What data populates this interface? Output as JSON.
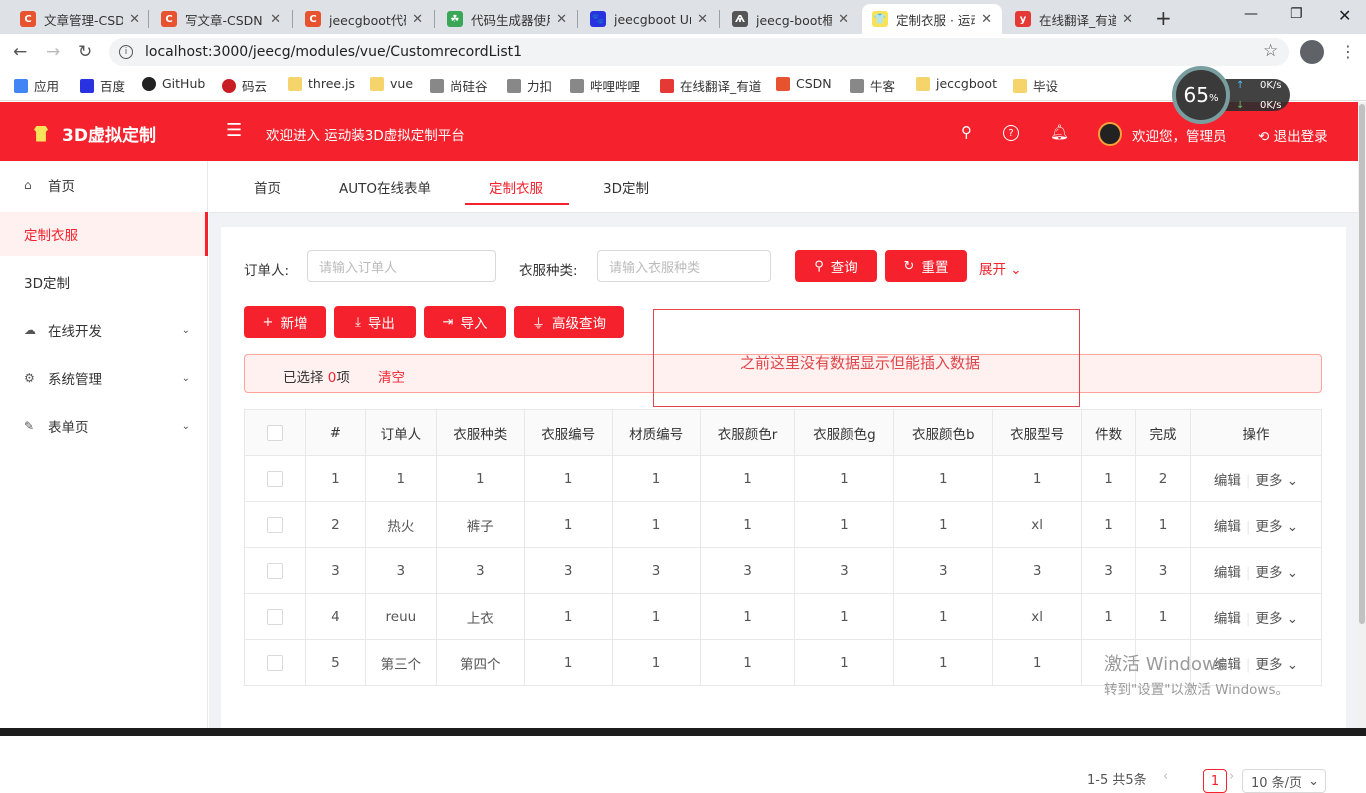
{
  "browser": {
    "tabs": [
      {
        "title": "文章管理-CSDN",
        "icon": "csdn-icon",
        "color": "#e8532f",
        "glyph": "C"
      },
      {
        "title": "写文章-CSDN",
        "icon": "csdn-icon",
        "color": "#e8532f",
        "glyph": "C"
      },
      {
        "title": "jeecgboot代码",
        "icon": "csdn-icon",
        "color": "#e8532f",
        "glyph": "C"
      },
      {
        "title": "代码生成器使用",
        "icon": "leaf-icon",
        "color": "#3aa757",
        "glyph": "☘"
      },
      {
        "title": "jeecgboot Un",
        "icon": "baidu-icon",
        "color": "#2932e1",
        "glyph": "🐾"
      },
      {
        "title": "jeecg-boot框",
        "icon": "jeecg-icon",
        "color": "#555555",
        "glyph": "Ѧ"
      },
      {
        "title": "定制衣服 · 运动",
        "icon": "shirt-icon",
        "color": "#f7e35a",
        "glyph": "👕"
      },
      {
        "title": "在线翻译_有道",
        "icon": "youdao-icon",
        "color": "#e53935",
        "glyph": "y"
      }
    ],
    "url": "localhost:3000/jeecg/modules/vue/CustomrecordList1",
    "bookmarks": [
      {
        "label": "应用",
        "type": "apps"
      },
      {
        "label": "百度",
        "type": "baidu"
      },
      {
        "label": "GitHub",
        "type": "github"
      },
      {
        "label": "码云",
        "type": "gitee"
      },
      {
        "label": "three.js",
        "type": "folder"
      },
      {
        "label": "vue",
        "type": "folder"
      },
      {
        "label": "尚硅谷",
        "type": "site"
      },
      {
        "label": "力扣",
        "type": "site"
      },
      {
        "label": "哔哩哔哩",
        "type": "site"
      },
      {
        "label": "在线翻译_有道",
        "type": "youdao"
      },
      {
        "label": "CSDN",
        "type": "csdn"
      },
      {
        "label": "牛客",
        "type": "site"
      },
      {
        "label": "jeccgboot",
        "type": "folder"
      },
      {
        "label": "毕设",
        "type": "folder"
      }
    ]
  },
  "header": {
    "app_title": "3D虚拟定制",
    "welcome": "欢迎进入 运动装3D虚拟定制平台",
    "user": "欢迎您，管理员",
    "logout": "退出登录"
  },
  "sidebar": {
    "items": [
      {
        "label": "首页",
        "icon": "home-icon"
      },
      {
        "label": "定制衣服",
        "active": true
      },
      {
        "label": "3D定制"
      },
      {
        "label": "在线开发",
        "icon": "cloud-icon",
        "expandable": true
      },
      {
        "label": "系统管理",
        "icon": "gear-icon",
        "expandable": true
      },
      {
        "label": "表单页",
        "icon": "form-icon",
        "expandable": true
      }
    ]
  },
  "page_tabs": [
    "首页",
    "AUTO在线表单",
    "定制衣服",
    "3D定制"
  ],
  "search": {
    "orderer_label": "订单人:",
    "orderer_placeholder": "请输入订单人",
    "type_label": "衣服种类:",
    "type_placeholder": "请输入衣服种类",
    "query": "查询",
    "reset": "重置",
    "expand": "展开"
  },
  "toolbar": {
    "add": "新增",
    "export": "导出",
    "import": "导入",
    "advanced": "高级查询"
  },
  "selection": {
    "prefix": "已选择",
    "count": "0",
    "suffix": "项",
    "clear": "清空"
  },
  "annotation": "之前这里没有数据显示但能插入数据",
  "table": {
    "columns": [
      "#",
      "订单人",
      "衣服种类",
      "衣服编号",
      "材质编号",
      "衣服颜色r",
      "衣服颜色g",
      "衣服颜色b",
      "衣服型号",
      "件数",
      "完成",
      "操作"
    ],
    "rows": [
      [
        "1",
        "1",
        "1",
        "1",
        "1",
        "1",
        "1",
        "1",
        "1",
        "1",
        "2"
      ],
      [
        "2",
        "热火",
        "裤子",
        "1",
        "1",
        "1",
        "1",
        "1",
        "xl",
        "1",
        "1"
      ],
      [
        "3",
        "3",
        "3",
        "3",
        "3",
        "3",
        "3",
        "3",
        "3",
        "3",
        "3"
      ],
      [
        "4",
        "reuu",
        "上衣",
        "1",
        "1",
        "1",
        "1",
        "1",
        "xl",
        "1",
        "1"
      ],
      [
        "5",
        "第三个",
        "第四个",
        "1",
        "1",
        "1",
        "1",
        "1",
        "1",
        "",
        ""
      ]
    ],
    "edit": "编辑",
    "more": "更多"
  },
  "pagination": {
    "total": "1-5 共5条",
    "current": "1",
    "page_size": "10 条/页"
  },
  "net_monitor": {
    "percent": "65",
    "up": "0K/s",
    "down": "0K/s"
  },
  "watermark": {
    "line1": "激活 Windows",
    "line2": "转到\"设置\"以激活 Windows。"
  },
  "colors": {
    "primary": "#f5222d",
    "alert_bg": "#fff1f0"
  }
}
